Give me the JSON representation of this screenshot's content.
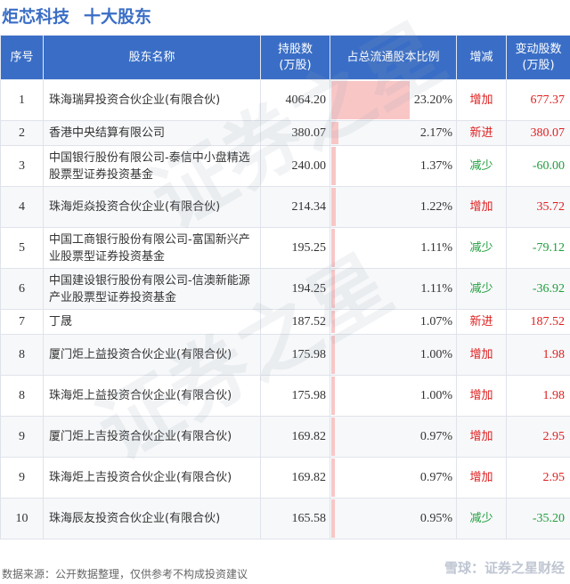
{
  "title": {
    "company": "炬芯科技",
    "subtitle": "十大股东"
  },
  "headers": {
    "rank": "序号",
    "name": "股东名称",
    "shares_line1": "持股数",
    "shares_line2": "(万股)",
    "ratio": "占总流通股本比例",
    "change": "增减",
    "delta_line1": "变动股数",
    "delta_line2": "(万股)"
  },
  "rows": [
    {
      "rank": "1",
      "name": "珠海瑞昇投资合伙企业(有限合伙)",
      "shares": "4064.20",
      "ratio": "23.20%",
      "ratio_value": 23.2,
      "change": "增加",
      "dir": "up",
      "delta": "677.37"
    },
    {
      "rank": "2",
      "name": "香港中央结算有限公司",
      "shares": "380.07",
      "ratio": "2.17%",
      "ratio_value": 2.17,
      "change": "新进",
      "dir": "up",
      "delta": "380.07"
    },
    {
      "rank": "3",
      "name": "中国银行股份有限公司-泰信中小盘精选股票型证券投资基金",
      "shares": "240.00",
      "ratio": "1.37%",
      "ratio_value": 1.37,
      "change": "减少",
      "dir": "down",
      "delta": "-60.00"
    },
    {
      "rank": "4",
      "name": "珠海炬焱投资合伙企业(有限合伙)",
      "shares": "214.34",
      "ratio": "1.22%",
      "ratio_value": 1.22,
      "change": "增加",
      "dir": "up",
      "delta": "35.72"
    },
    {
      "rank": "5",
      "name": "中国工商银行股份有限公司-富国新兴产业股票型证券投资基金",
      "shares": "195.25",
      "ratio": "1.11%",
      "ratio_value": 1.11,
      "change": "减少",
      "dir": "down",
      "delta": "-79.12"
    },
    {
      "rank": "6",
      "name": "中国建设银行股份有限公司-信澳新能源产业股票型证券投资基金",
      "shares": "194.25",
      "ratio": "1.11%",
      "ratio_value": 1.11,
      "change": "减少",
      "dir": "down",
      "delta": "-36.92"
    },
    {
      "rank": "7",
      "name": "丁晟",
      "shares": "187.52",
      "ratio": "1.07%",
      "ratio_value": 1.07,
      "change": "新进",
      "dir": "up",
      "delta": "187.52"
    },
    {
      "rank": "8",
      "name": "厦门炬上益投资合伙企业(有限合伙)",
      "shares": "175.98",
      "ratio": "1.00%",
      "ratio_value": 1.0,
      "change": "增加",
      "dir": "up",
      "delta": "1.98"
    },
    {
      "rank": "8",
      "name": "珠海炬上益投资合伙企业(有限合伙)",
      "shares": "175.98",
      "ratio": "1.00%",
      "ratio_value": 1.0,
      "change": "增加",
      "dir": "up",
      "delta": "1.98"
    },
    {
      "rank": "9",
      "name": "厦门炬上吉投资合伙企业(有限合伙)",
      "shares": "169.82",
      "ratio": "0.97%",
      "ratio_value": 0.97,
      "change": "增加",
      "dir": "up",
      "delta": "2.95"
    },
    {
      "rank": "9",
      "name": "珠海炬上吉投资合伙企业(有限合伙)",
      "shares": "169.82",
      "ratio": "0.97%",
      "ratio_value": 0.97,
      "change": "增加",
      "dir": "up",
      "delta": "2.95"
    },
    {
      "rank": "10",
      "name": "珠海辰友投资合伙企业(有限合伙)",
      "shares": "165.58",
      "ratio": "0.95%",
      "ratio_value": 0.95,
      "change": "减少",
      "dir": "down",
      "delta": "-35.20"
    }
  ],
  "footer": {
    "source": "数据来源：公开数据整理，仅供参考不构成投资建议",
    "brand": "雪球：证券之星财经"
  },
  "colors": {
    "header_bg": "#3a6ec6",
    "title": "#3a6ec6",
    "increase": "#e02020",
    "decrease": "#1f9e3c",
    "bar": "#f9c6c6"
  }
}
